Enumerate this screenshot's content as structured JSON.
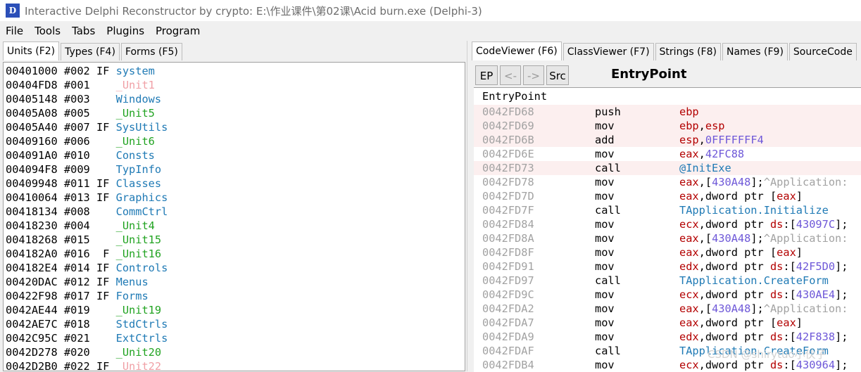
{
  "window": {
    "title": "Interactive Delphi Reconstructor by crypto: E:\\作业课件\\第02课\\Acid burn.exe (Delphi-3)",
    "icon": "app-logo-icon"
  },
  "menu": [
    "File",
    "Tools",
    "Tabs",
    "Plugins",
    "Program"
  ],
  "left_tabs": [
    "Units (F2)",
    "Types (F4)",
    "Forms (F5)"
  ],
  "right_tabs": [
    "CodeViewer (F6)",
    "ClassViewer (F7)",
    "Strings (F8)",
    "Names (F9)",
    "SourceCode"
  ],
  "toolbar": {
    "ep": "EP",
    "back": "<-",
    "fwd": "->",
    "src": "Src",
    "title": "EntryPoint"
  },
  "units": [
    {
      "addr": "00401000",
      "num": "#002",
      "flags": "IF",
      "name": "system",
      "color": "blue"
    },
    {
      "addr": "00404FD8",
      "num": "#001",
      "flags": "  ",
      "name": "_Unit1",
      "color": "pink"
    },
    {
      "addr": "00405148",
      "num": "#003",
      "flags": "  ",
      "name": "Windows",
      "color": "blue"
    },
    {
      "addr": "00405A08",
      "num": "#005",
      "flags": "  ",
      "name": "_Unit5",
      "color": "green"
    },
    {
      "addr": "00405A40",
      "num": "#007",
      "flags": "IF",
      "name": "SysUtils",
      "color": "blue"
    },
    {
      "addr": "00409160",
      "num": "#006",
      "flags": "  ",
      "name": "_Unit6",
      "color": "green"
    },
    {
      "addr": "004091A0",
      "num": "#010",
      "flags": "  ",
      "name": "Consts",
      "color": "blue"
    },
    {
      "addr": "004094F8",
      "num": "#009",
      "flags": "  ",
      "name": "TypInfo",
      "color": "blue"
    },
    {
      "addr": "00409948",
      "num": "#011",
      "flags": "IF",
      "name": "Classes",
      "color": "blue"
    },
    {
      "addr": "00410064",
      "num": "#013",
      "flags": "IF",
      "name": "Graphics",
      "color": "blue"
    },
    {
      "addr": "00418134",
      "num": "#008",
      "flags": "  ",
      "name": "CommCtrl",
      "color": "blue"
    },
    {
      "addr": "00418230",
      "num": "#004",
      "flags": "  ",
      "name": "_Unit4",
      "color": "green"
    },
    {
      "addr": "00418268",
      "num": "#015",
      "flags": "  ",
      "name": "_Unit15",
      "color": "green"
    },
    {
      "addr": "004182A0",
      "num": "#016",
      "flags": " F",
      "name": "_Unit16",
      "color": "green"
    },
    {
      "addr": "004182E4",
      "num": "#014",
      "flags": "IF",
      "name": "Controls",
      "color": "blue"
    },
    {
      "addr": "00420DAC",
      "num": "#012",
      "flags": "IF",
      "name": "Menus",
      "color": "blue"
    },
    {
      "addr": "00422F98",
      "num": "#017",
      "flags": "IF",
      "name": "Forms",
      "color": "blue"
    },
    {
      "addr": "0042AE44",
      "num": "#019",
      "flags": "  ",
      "name": "_Unit19",
      "color": "green"
    },
    {
      "addr": "0042AE7C",
      "num": "#018",
      "flags": "  ",
      "name": "StdCtrls",
      "color": "blue"
    },
    {
      "addr": "0042C95C",
      "num": "#021",
      "flags": "  ",
      "name": "ExtCtrls",
      "color": "blue"
    },
    {
      "addr": "0042D278",
      "num": "#020",
      "flags": "  ",
      "name": "_Unit20",
      "color": "green"
    },
    {
      "addr": "0042D2B0",
      "num": "#022",
      "flags": "IF",
      "name": "_Unit22",
      "color": "pink"
    }
  ],
  "code_header": "EntryPoint",
  "code": [
    {
      "addr": "0042FD68",
      "mn": "push",
      "hl": true,
      "ops": [
        [
          "reg",
          "ebp"
        ]
      ]
    },
    {
      "addr": "0042FD69",
      "mn": "mov",
      "hl": true,
      "ops": [
        [
          "reg",
          "ebp"
        ],
        [
          "txt",
          ","
        ],
        [
          "reg",
          "esp"
        ]
      ]
    },
    {
      "addr": "0042FD6B",
      "mn": "add",
      "hl": true,
      "ops": [
        [
          "reg",
          "esp"
        ],
        [
          "txt",
          ","
        ],
        [
          "num",
          "0FFFFFFF4"
        ]
      ]
    },
    {
      "addr": "0042FD6E",
      "mn": "mov",
      "hl": false,
      "ops": [
        [
          "reg",
          "eax"
        ],
        [
          "txt",
          ","
        ],
        [
          "num",
          "42FC88"
        ]
      ]
    },
    {
      "addr": "0042FD73",
      "mn": "call",
      "hl": true,
      "ops": [
        [
          "func",
          "@InitExe"
        ]
      ]
    },
    {
      "addr": "0042FD78",
      "mn": "mov",
      "hl": false,
      "ops": [
        [
          "reg",
          "eax"
        ],
        [
          "txt",
          ",["
        ],
        [
          "num",
          "430A48"
        ],
        [
          "txt",
          "];"
        ],
        [
          "cmt",
          "^Application:"
        ]
      ]
    },
    {
      "addr": "0042FD7D",
      "mn": "mov",
      "hl": false,
      "ops": [
        [
          "reg",
          "eax"
        ],
        [
          "txt",
          ",dword ptr ["
        ],
        [
          "reg",
          "eax"
        ],
        [
          "txt",
          "]"
        ]
      ]
    },
    {
      "addr": "0042FD7F",
      "mn": "call",
      "hl": false,
      "ops": [
        [
          "func",
          "TApplication.Initialize"
        ]
      ]
    },
    {
      "addr": "0042FD84",
      "mn": "mov",
      "hl": false,
      "ops": [
        [
          "reg",
          "ecx"
        ],
        [
          "txt",
          ",dword ptr "
        ],
        [
          "seg",
          "ds"
        ],
        [
          "txt",
          ":["
        ],
        [
          "num",
          "43097C"
        ],
        [
          "txt",
          "];"
        ]
      ]
    },
    {
      "addr": "0042FD8A",
      "mn": "mov",
      "hl": false,
      "ops": [
        [
          "reg",
          "eax"
        ],
        [
          "txt",
          ",["
        ],
        [
          "num",
          "430A48"
        ],
        [
          "txt",
          "];"
        ],
        [
          "cmt",
          "^Application:"
        ]
      ]
    },
    {
      "addr": "0042FD8F",
      "mn": "mov",
      "hl": false,
      "ops": [
        [
          "reg",
          "eax"
        ],
        [
          "txt",
          ",dword ptr ["
        ],
        [
          "reg",
          "eax"
        ],
        [
          "txt",
          "]"
        ]
      ]
    },
    {
      "addr": "0042FD91",
      "mn": "mov",
      "hl": false,
      "ops": [
        [
          "reg",
          "edx"
        ],
        [
          "txt",
          ",dword ptr "
        ],
        [
          "seg",
          "ds"
        ],
        [
          "txt",
          ":["
        ],
        [
          "num",
          "42F5D0"
        ],
        [
          "txt",
          "];"
        ]
      ]
    },
    {
      "addr": "0042FD97",
      "mn": "call",
      "hl": false,
      "ops": [
        [
          "func",
          "TApplication.CreateForm"
        ]
      ]
    },
    {
      "addr": "0042FD9C",
      "mn": "mov",
      "hl": false,
      "ops": [
        [
          "reg",
          "ecx"
        ],
        [
          "txt",
          ",dword ptr "
        ],
        [
          "seg",
          "ds"
        ],
        [
          "txt",
          ":["
        ],
        [
          "num",
          "430AE4"
        ],
        [
          "txt",
          "];"
        ]
      ]
    },
    {
      "addr": "0042FDA2",
      "mn": "mov",
      "hl": false,
      "ops": [
        [
          "reg",
          "eax"
        ],
        [
          "txt",
          ",["
        ],
        [
          "num",
          "430A48"
        ],
        [
          "txt",
          "];"
        ],
        [
          "cmt",
          "^Application:"
        ]
      ]
    },
    {
      "addr": "0042FDA7",
      "mn": "mov",
      "hl": false,
      "ops": [
        [
          "reg",
          "eax"
        ],
        [
          "txt",
          ",dword ptr ["
        ],
        [
          "reg",
          "eax"
        ],
        [
          "txt",
          "]"
        ]
      ]
    },
    {
      "addr": "0042FDA9",
      "mn": "mov",
      "hl": false,
      "ops": [
        [
          "reg",
          "edx"
        ],
        [
          "txt",
          ",dword ptr "
        ],
        [
          "seg",
          "ds"
        ],
        [
          "txt",
          ":["
        ],
        [
          "num",
          "42F838"
        ],
        [
          "txt",
          "];"
        ]
      ]
    },
    {
      "addr": "0042FDAF",
      "mn": "call",
      "hl": false,
      "ops": [
        [
          "func",
          "TApplication.CreateForm"
        ]
      ]
    },
    {
      "addr": "0042FDB4",
      "mn": "mov",
      "hl": false,
      "ops": [
        [
          "reg",
          "ecx"
        ],
        [
          "txt",
          ",dword ptr "
        ],
        [
          "seg",
          "ds"
        ],
        [
          "txt",
          ":["
        ],
        [
          "num",
          "430964"
        ],
        [
          "txt",
          "];"
        ]
      ]
    }
  ],
  "watermark": "CSDN @shirytuo小伙子"
}
